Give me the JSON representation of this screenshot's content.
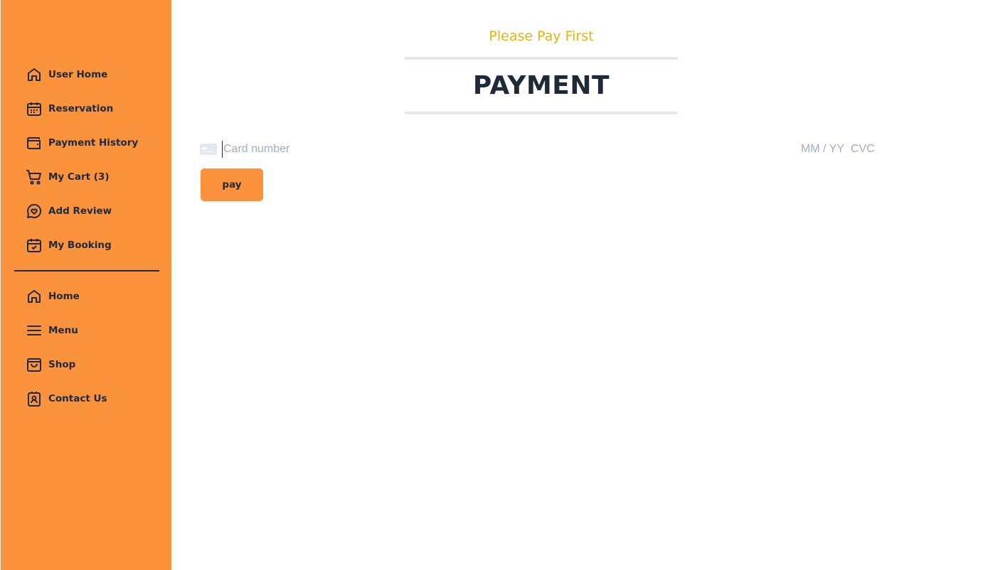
{
  "sidebar": {
    "top_items": [
      {
        "label": "User Home",
        "icon": "home-icon"
      },
      {
        "label": "Reservation",
        "icon": "calendar-icon"
      },
      {
        "label": "Payment History",
        "icon": "wallet-icon"
      },
      {
        "label": "My Cart (3)",
        "icon": "cart-icon"
      },
      {
        "label": "Add Review",
        "icon": "review-icon"
      },
      {
        "label": "My Booking",
        "icon": "calendar-check-icon"
      }
    ],
    "bottom_items": [
      {
        "label": "Home",
        "icon": "home-icon"
      },
      {
        "label": "Menu",
        "icon": "menu-icon"
      },
      {
        "label": "Shop",
        "icon": "shopping-bag-icon"
      },
      {
        "label": "Contact Us",
        "icon": "contact-icon"
      }
    ]
  },
  "main": {
    "subtitle": "Please Pay First",
    "title": "PAYMENT",
    "card": {
      "number_placeholder": "Card number",
      "expiry_placeholder": "MM / YY",
      "cvc_placeholder": "CVC",
      "icon": "credit-card-icon"
    },
    "pay_label": "pay"
  },
  "colors": {
    "sidebar_bg": "#fb923c",
    "subtitle": "#eab308",
    "text_dark": "#1f2937",
    "placeholder": "#a0aec0",
    "rule": "#e5e7eb"
  }
}
